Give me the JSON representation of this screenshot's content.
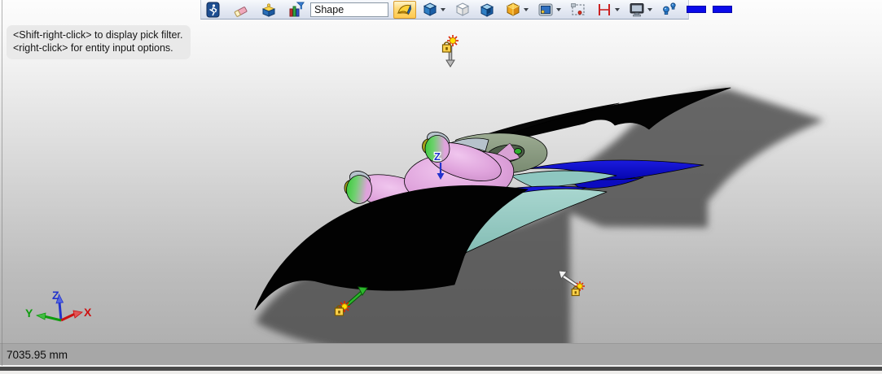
{
  "window": {
    "status_measurement": "7035.95 mm"
  },
  "toolbar": {
    "shape_field": {
      "value": "Shape"
    },
    "icons": [
      {
        "name": "motion-runner-icon"
      },
      {
        "name": "eraser-icon"
      },
      {
        "name": "extrude-box-icon"
      },
      {
        "name": "chart-filter-icon"
      },
      {
        "name": "surface-mode-icon",
        "active": true
      },
      {
        "name": "solid-cube-icon",
        "dropdown": true
      },
      {
        "name": "wireframe-cube-icon"
      },
      {
        "name": "section-cube-icon"
      },
      {
        "name": "facet-cube-icon",
        "dropdown": true
      },
      {
        "name": "camera-view-icon",
        "dropdown": true
      },
      {
        "name": "selection-region-icon"
      },
      {
        "name": "dimension-icon",
        "dropdown": true
      },
      {
        "name": "display-monitor-icon",
        "dropdown": true
      },
      {
        "name": "lights-icon"
      },
      {
        "name": "blue-swatch-1"
      },
      {
        "name": "blue-swatch-2"
      }
    ]
  },
  "hint": {
    "line1": "<Shift-right-click> to display pick filter.",
    "line2": "<right-click> for entity input options."
  },
  "viewport": {
    "z_marker_label": "Z",
    "triad": {
      "x_label": "X",
      "y_label": "Y",
      "z_label": "Z",
      "x_color": "#cc1111",
      "y_color": "#0e9c0e",
      "z_color": "#2233cc"
    },
    "model_colors": {
      "wing_black": "#050505",
      "wing_blue": "#1010cc",
      "wing_teal": "#8ec7c0",
      "fuselage_pink": "#dfa3dc",
      "nose_green": "#3ecb3e",
      "nose_ring": "#b6c2cb",
      "nose_cap": "#a3a01c",
      "canopy_sage": "#8b9c84",
      "shadow": "#4a4a4a"
    }
  }
}
